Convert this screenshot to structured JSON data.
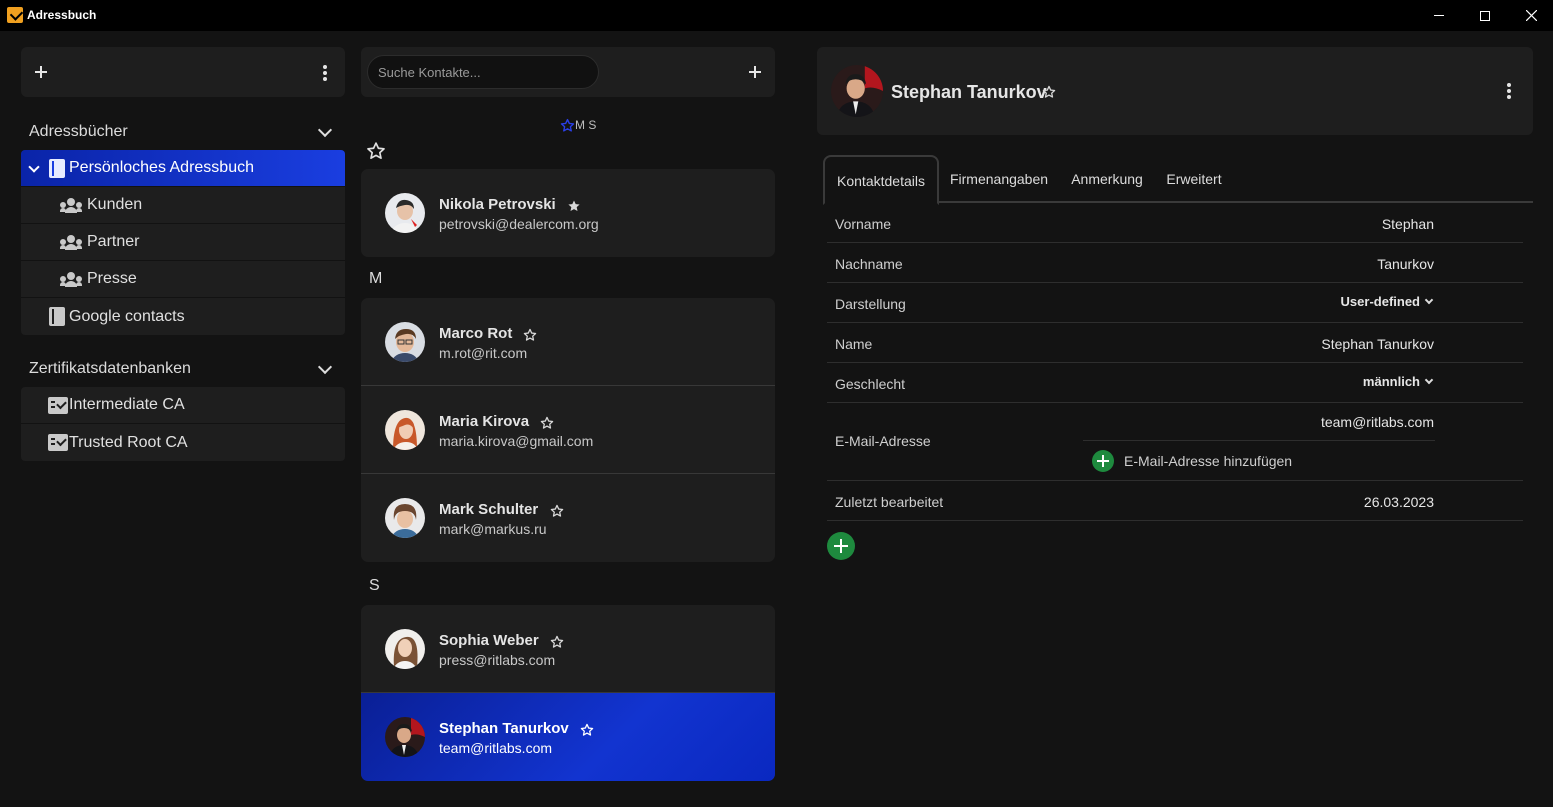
{
  "window": {
    "title": "Adressbuch",
    "logo_icon": "app-logo-icon"
  },
  "left": {
    "addressbooks_heading": "Adressbücher",
    "addressbooks": [
      {
        "label": "Persönloches Adressbuch",
        "icon": "book-icon",
        "expanded": true,
        "selected": true
      },
      {
        "label": "Kunden",
        "icon": "group-icon",
        "child": true
      },
      {
        "label": "Partner",
        "icon": "group-icon",
        "child": true
      },
      {
        "label": "Presse",
        "icon": "group-icon",
        "child": true
      },
      {
        "label": "Google contacts",
        "icon": "book-icon"
      }
    ],
    "certs_heading": "Zertifikatsdatenbanken",
    "certs": [
      {
        "label": "Intermediate CA",
        "icon": "certificate-icon"
      },
      {
        "label": "Trusted Root CA",
        "icon": "certificate-icon"
      }
    ]
  },
  "middle": {
    "search": {
      "placeholder": "Suche Kontakte..."
    },
    "alpha_index": "M S",
    "favorites": [
      {
        "name": "Nikola Petrovski",
        "email": "petrovski@dealercom.org",
        "favorite": true
      }
    ],
    "letter_m": "M",
    "group_m": [
      {
        "name": "Marco Rot",
        "email": "m.rot@rit.com",
        "favorite": false
      },
      {
        "name": "Maria Kirova",
        "email": "maria.kirova@gmail.com",
        "favorite": false
      },
      {
        "name": "Mark Schulter",
        "email": "mark@markus.ru",
        "favorite": false
      }
    ],
    "letter_s": "S",
    "group_s": [
      {
        "name": "Sophia Weber",
        "email": "press@ritlabs.com",
        "favorite": false
      },
      {
        "name": "Stephan Tanurkov",
        "email": "team@ritlabs.com",
        "favorite": false,
        "selected": true
      }
    ]
  },
  "detail": {
    "name": "Stephan Tanurkov",
    "tabs": [
      "Kontaktdetails",
      "Firmenangaben",
      "Anmerkung",
      "Erweitert"
    ],
    "active_tab": "Kontaktdetails",
    "fields": {
      "vorname_label": "Vorname",
      "vorname": "Stephan",
      "nachname_label": "Nachname",
      "nachname": "Tanurkov",
      "darstellung_label": "Darstellung",
      "darstellung": "User-defined",
      "name_label": "Name",
      "name": "Stephan Tanurkov",
      "geschlecht_label": "Geschlecht",
      "geschlecht": "männlich",
      "email_label": "E-Mail-Adresse",
      "email": "team@ritlabs.com",
      "add_email": "E-Mail-Adresse hinzufügen",
      "edited_label": "Zuletzt bearbeitet",
      "edited": "26.03.2023"
    }
  },
  "colors": {
    "accent": "#1234d0",
    "add_green": "#1e8a3e",
    "background": "#131313",
    "panel": "#1e1e1e"
  }
}
